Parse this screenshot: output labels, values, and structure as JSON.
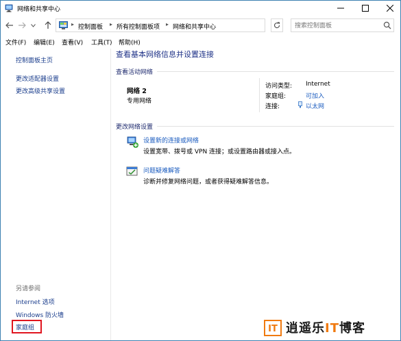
{
  "window": {
    "title": "网络和共享中心"
  },
  "address_bar": {
    "crumbs": [
      "控制面板",
      "所有控制面板项",
      "网络和共享中心"
    ],
    "search_placeholder": "搜索控制面板"
  },
  "menu": {
    "items": [
      "文件(F)",
      "编辑(E)",
      "查看(V)",
      "工具(T)",
      "帮助(H)"
    ]
  },
  "left_panel": {
    "home": "控制面板主页",
    "links": [
      "更改适配器设置",
      "更改高级共享设置"
    ],
    "see_also_heading": "另请参阅",
    "see_also": [
      "Internet 选项",
      "Windows 防火墙",
      "家庭组"
    ]
  },
  "main": {
    "title": "查看基本网络信息并设置连接",
    "active_networks_label": "查看活动网络",
    "network": {
      "name": "网络  2",
      "profile": "专用网络",
      "access_type_label": "访问类型:",
      "access_type_value": "Internet",
      "homegroup_label": "家庭组:",
      "homegroup_value": "可加入",
      "connection_label": "连接:",
      "connection_value": "以太网"
    },
    "change_settings_label": "更改网络设置",
    "tasks": [
      {
        "title": "设置新的连接或网络",
        "description": "设置宽带、拨号或 VPN 连接；或设置路由器或接入点。",
        "icon": "new-connection-icon"
      },
      {
        "title": "问题疑难解答",
        "description": "诊断并修复网络问题，或者获得疑难解答信息。",
        "icon": "troubleshoot-icon"
      }
    ]
  },
  "watermark": {
    "logo_glyph": "IT",
    "text_left": "逍遥乐",
    "text_accent": "IT",
    "text_right": "博客",
    "accent_color": "#f07a10"
  },
  "colors": {
    "link": "#1a5bbf",
    "left_link": "#1a3d8c",
    "title": "#1e3287",
    "highlight": "#e0141e"
  }
}
